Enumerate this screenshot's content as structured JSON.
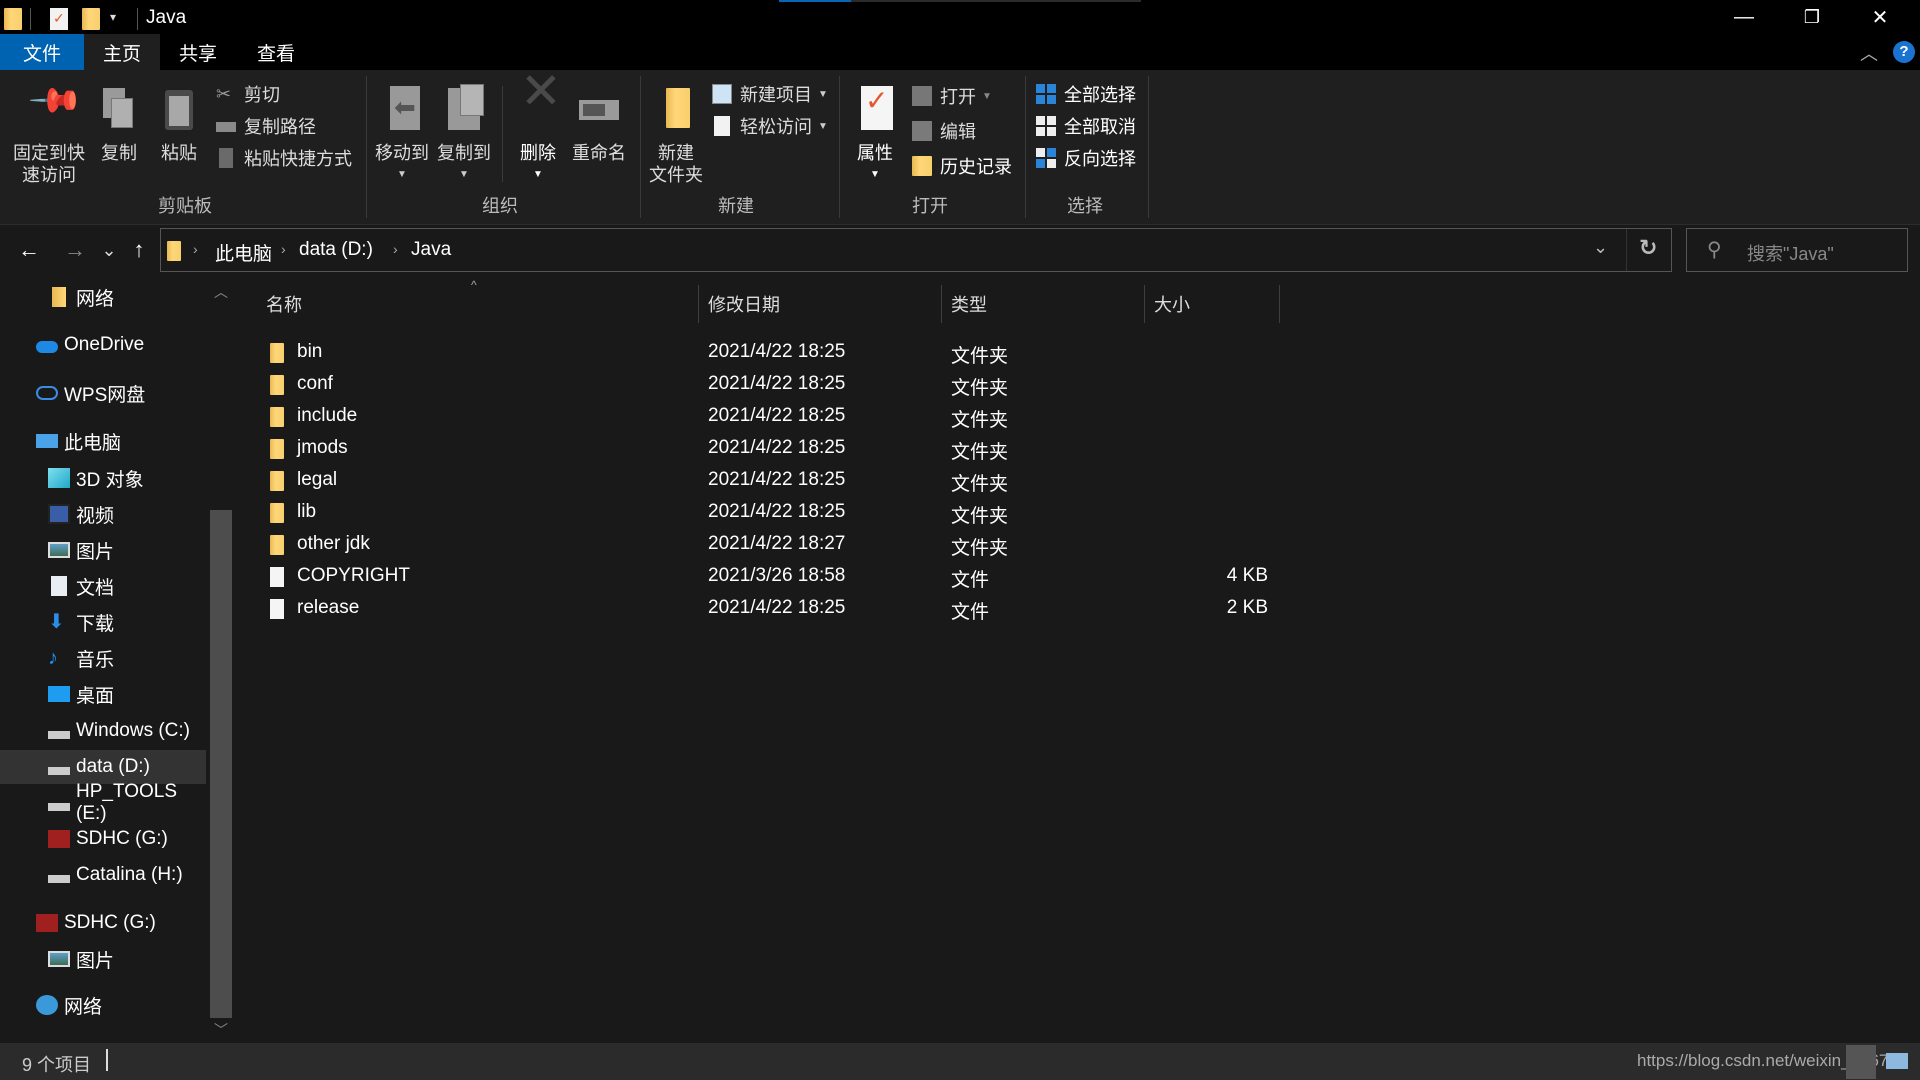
{
  "window": {
    "title": "Java",
    "controls": {
      "minimize": "—",
      "restore": "❐",
      "close": "✕"
    },
    "progress_percent": 20,
    "colors": {
      "accent": "#0a64b8",
      "background": "#191919",
      "ribbon": "#1f1f1f",
      "folder": "#f7cf6c"
    }
  },
  "ribbon_tabs": [
    {
      "label": "文件",
      "active_color": "#0063b1"
    },
    {
      "label": "主页",
      "selected": true
    },
    {
      "label": "共享"
    },
    {
      "label": "查看"
    }
  ],
  "ribbon": {
    "clipboard": {
      "label": "剪贴板",
      "pin": "固定到快\n速访问",
      "pin_line1": "固定到快",
      "pin_line2": "速访问",
      "copy": "复制",
      "paste": "粘贴",
      "cut": "剪切",
      "copy_path": "复制路径",
      "paste_shortcut": "粘贴快捷方式"
    },
    "organize": {
      "label": "组织",
      "move_to": "移动到",
      "copy_to": "复制到",
      "delete": "删除",
      "rename": "重命名"
    },
    "new": {
      "label": "新建",
      "new_folder_line1": "新建",
      "new_folder_line2": "文件夹",
      "new_item": "新建项目",
      "easy_access": "轻松访问"
    },
    "open": {
      "label": "打开",
      "properties": "属性",
      "open": "打开",
      "edit": "编辑",
      "history": "历史记录"
    },
    "select": {
      "label": "选择",
      "select_all": "全部选择",
      "select_none": "全部取消",
      "invert": "反向选择"
    }
  },
  "nav": {
    "back": "←",
    "forward": "→",
    "recent": "⌄",
    "up": "↑",
    "breadcrumb": [
      "此电脑",
      "data (D:)",
      "Java"
    ],
    "refresh": "↻",
    "dropdown": "⌄",
    "search_placeholder": "搜索\"Java\""
  },
  "sidebar": {
    "items": [
      {
        "label": "网络",
        "icon": "folder-icon",
        "indent": 2
      },
      {
        "label": "OneDrive",
        "icon": "onedrive-cloud-icon",
        "indent": 1
      },
      {
        "label": "WPS网盘",
        "icon": "wps-cloud-icon",
        "indent": 1
      },
      {
        "label": "此电脑",
        "icon": "this-pc-icon",
        "indent": 1
      },
      {
        "label": "3D 对象",
        "icon": "3d-objects-icon",
        "indent": 2
      },
      {
        "label": "视频",
        "icon": "videos-icon",
        "indent": 2
      },
      {
        "label": "图片",
        "icon": "pictures-icon",
        "indent": 2
      },
      {
        "label": "文档",
        "icon": "documents-icon",
        "indent": 2
      },
      {
        "label": "下载",
        "icon": "downloads-icon",
        "indent": 2
      },
      {
        "label": "音乐",
        "icon": "music-icon",
        "indent": 2
      },
      {
        "label": "桌面",
        "icon": "desktop-icon",
        "indent": 2
      },
      {
        "label": "Windows (C:)",
        "icon": "windows-drive-icon",
        "indent": 2
      },
      {
        "label": "data (D:)",
        "icon": "drive-icon",
        "indent": 2,
        "selected": true
      },
      {
        "label": "HP_TOOLS (E:)",
        "icon": "drive-icon",
        "indent": 2
      },
      {
        "label": "SDHC (G:)",
        "icon": "sd-card-icon",
        "indent": 2
      },
      {
        "label": "Catalina (H:)",
        "icon": "drive-icon",
        "indent": 2
      },
      {
        "label": "SDHC (G:)",
        "icon": "sd-card-icon",
        "indent": 1
      },
      {
        "label": "图片",
        "icon": "pictures-icon",
        "indent": 2
      },
      {
        "label": "网络",
        "icon": "network-icon",
        "indent": 1
      }
    ]
  },
  "columns": {
    "name": "名称",
    "modified": "修改日期",
    "type": "类型",
    "size": "大小"
  },
  "files": [
    {
      "name": "bin",
      "modified": "2021/4/22 18:25",
      "type": "文件夹",
      "size": "",
      "kind": "folder"
    },
    {
      "name": "conf",
      "modified": "2021/4/22 18:25",
      "type": "文件夹",
      "size": "",
      "kind": "folder"
    },
    {
      "name": "include",
      "modified": "2021/4/22 18:25",
      "type": "文件夹",
      "size": "",
      "kind": "folder"
    },
    {
      "name": "jmods",
      "modified": "2021/4/22 18:25",
      "type": "文件夹",
      "size": "",
      "kind": "folder"
    },
    {
      "name": "legal",
      "modified": "2021/4/22 18:25",
      "type": "文件夹",
      "size": "",
      "kind": "folder"
    },
    {
      "name": "lib",
      "modified": "2021/4/22 18:25",
      "type": "文件夹",
      "size": "",
      "kind": "folder"
    },
    {
      "name": "other jdk",
      "modified": "2021/4/22 18:27",
      "type": "文件夹",
      "size": "",
      "kind": "folder"
    },
    {
      "name": "COPYRIGHT",
      "modified": "2021/3/26 18:58",
      "type": "文件",
      "size": "4 KB",
      "kind": "file"
    },
    {
      "name": "release",
      "modified": "2021/4/22 18:25",
      "type": "文件",
      "size": "2 KB",
      "kind": "file"
    }
  ],
  "status": {
    "count": "9 个项目",
    "watermark": "https://blog.csdn.net/weixin_46671"
  }
}
